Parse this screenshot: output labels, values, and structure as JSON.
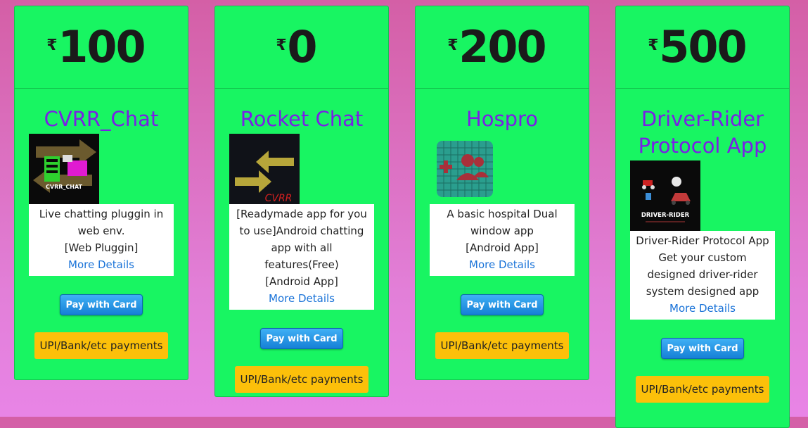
{
  "currency_symbol": "₹",
  "colors": {
    "card_bg": "#18f562",
    "title": "#7a1fe6",
    "link": "#1a73d8",
    "pay_button": "#1680d6",
    "upi_button": "#fcc00a"
  },
  "products": [
    {
      "price": "100",
      "title": "CVRR_Chat",
      "thumb_icon": "cvrr-chat-logo-icon",
      "thumb_text": "CVRR_CHAT",
      "description": [
        "Live chatting pluggin in web env.",
        "[Web Pluggin]"
      ],
      "more_details": "More Details",
      "pay_label": "Pay with Card",
      "upi_label": "UPI/Bank/etc payments"
    },
    {
      "price": "0",
      "title": "Rocket Chat",
      "thumb_icon": "rocket-chat-logo-icon",
      "thumb_text": "CVRR",
      "description": [
        "[Readymade app for you to use]Android chatting app with all features(Free)",
        "[Android App]"
      ],
      "more_details": "More Details",
      "pay_label": "Pay with Card",
      "upi_label": "UPI/Bank/etc payments"
    },
    {
      "price": "200",
      "title": "Hospro",
      "thumb_icon": "hospro-logo-icon",
      "description": [
        "A basic hospital Dual window app",
        "[Android App]"
      ],
      "more_details": "More Details",
      "pay_label": "Pay with Card",
      "upi_label": "UPI/Bank/etc payments"
    },
    {
      "price": "500",
      "title": "Driver-Rider Protocol App",
      "thumb_icon": "driver-rider-logo-icon",
      "thumb_text": "DRIVER-RIDER",
      "description": [
        "Driver-Rider Protocol App",
        "Get your custom designed driver-rider system designed app"
      ],
      "more_details": "More Details",
      "pay_label": "Pay with Card",
      "upi_label": "UPI/Bank/etc payments"
    }
  ]
}
